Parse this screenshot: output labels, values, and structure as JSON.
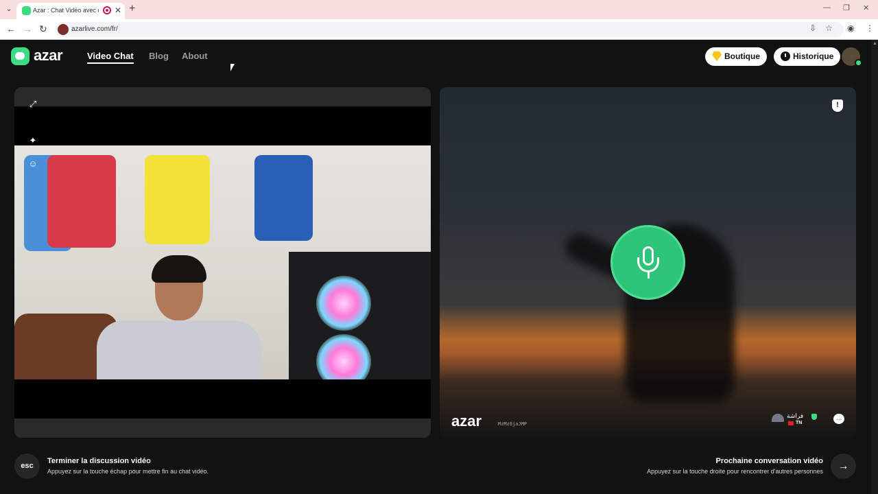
{
  "browser": {
    "tab_title": "Azar : Chat Vidéo avec de n",
    "url": "azarlive.com/fr/",
    "tab_list_icon": "chevron-down-icon",
    "new_tab_icon": "plus-icon"
  },
  "header": {
    "logo_text": "azar",
    "nav": [
      {
        "label": "Video Chat",
        "active": true
      },
      {
        "label": "Blog",
        "active": false
      },
      {
        "label": "About",
        "active": false
      }
    ],
    "shop_label": "Boutique",
    "history_label": "Historique"
  },
  "self_view": {
    "tools": [
      "expand-icon",
      "magic-wand-icon",
      "face-filter-icon"
    ]
  },
  "remote_view": {
    "watermark": "azar",
    "watermark_id": "MzMz6jaJMP",
    "peer_name": "فراشة",
    "peer_country": "TN"
  },
  "footer": {
    "end": {
      "key": "esc",
      "title": "Terminer la discussion vidéo",
      "desc": "Appuyez sur la touche échap pour mettre fin au chat vidéo."
    },
    "next": {
      "key_icon": "arrow-right-icon",
      "title": "Prochaine conversation vidéo",
      "desc": "Appuyez sur la touche droite pour rencontrer d'autres personnes"
    }
  },
  "colors": {
    "brand_green": "#3ddc84",
    "background": "#121212",
    "mic_green": "#2ec47a"
  }
}
